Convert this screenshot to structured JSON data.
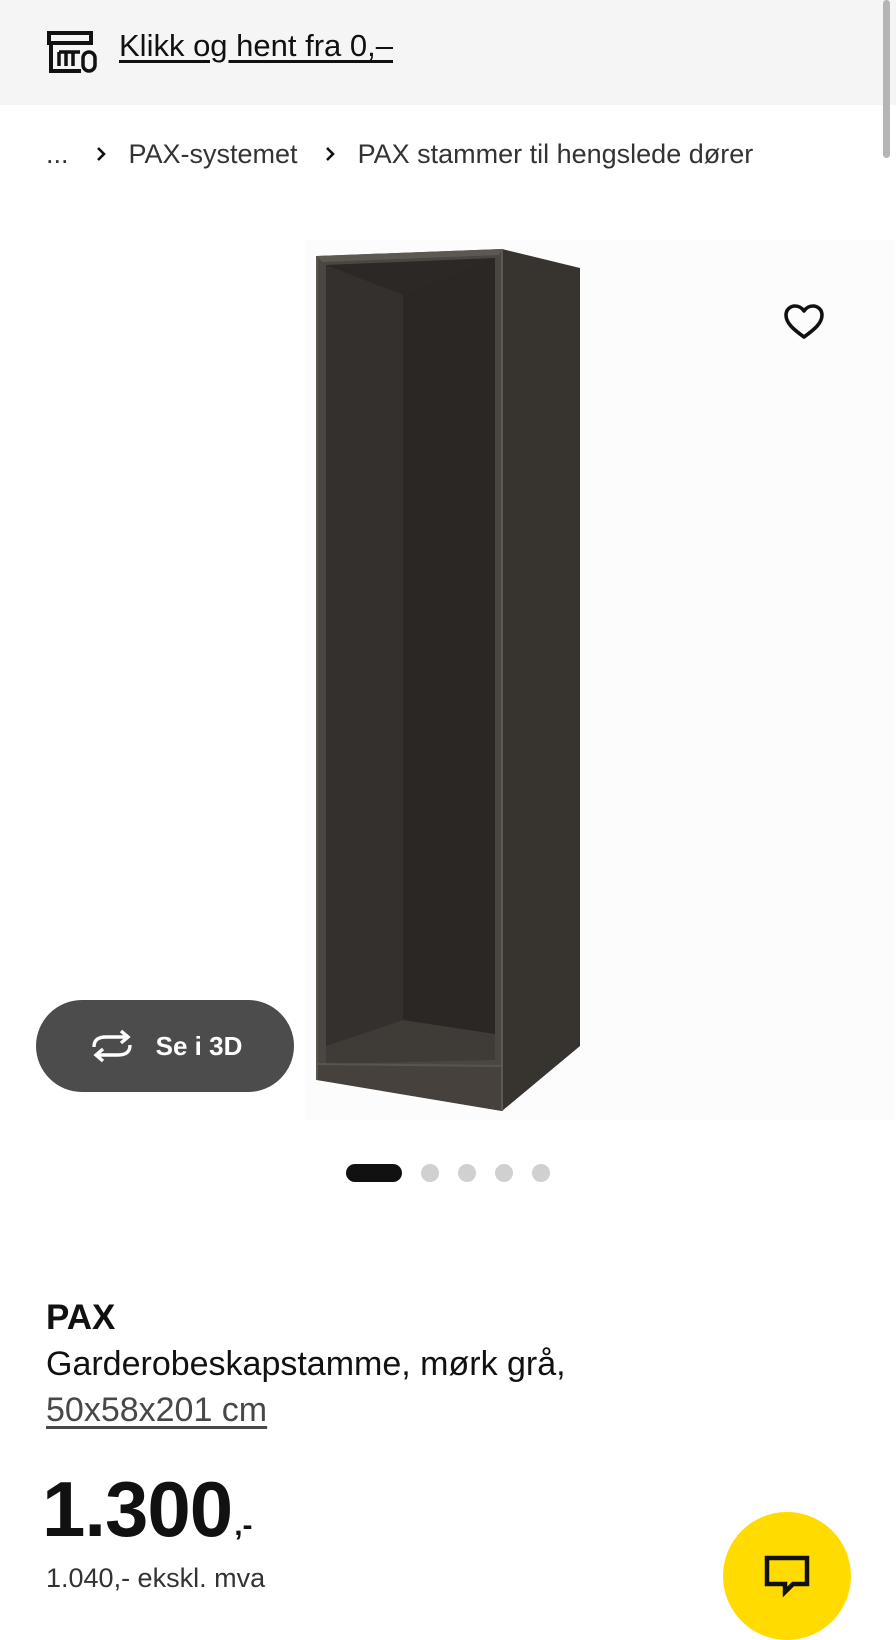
{
  "topbar": {
    "store_link": "Klikk og hent fra 0,–"
  },
  "breadcrumb": {
    "ellipsis": "...",
    "items": [
      "PAX-systemet",
      "PAX stammer til hengslede dører"
    ]
  },
  "gallery": {
    "view_3d_label": "Se i 3D",
    "slide_count": 5,
    "active_slide": 1
  },
  "product": {
    "brand": "PAX",
    "description": "Garderobeskapstamme, mørk grå,",
    "size": "50x58x201 cm",
    "price_integer": "1.300",
    "price_suffix": ",-",
    "price_ex_vat": "1.040,- ekskl. mva"
  },
  "colors": {
    "chat_button": "#ffdb00",
    "cabinet": "#3a3633",
    "topbar": "#f5f5f5"
  },
  "icons": [
    "store-icon",
    "chevron-right-icon",
    "heart-icon",
    "rotate-3d-icon",
    "chat-icon"
  ]
}
